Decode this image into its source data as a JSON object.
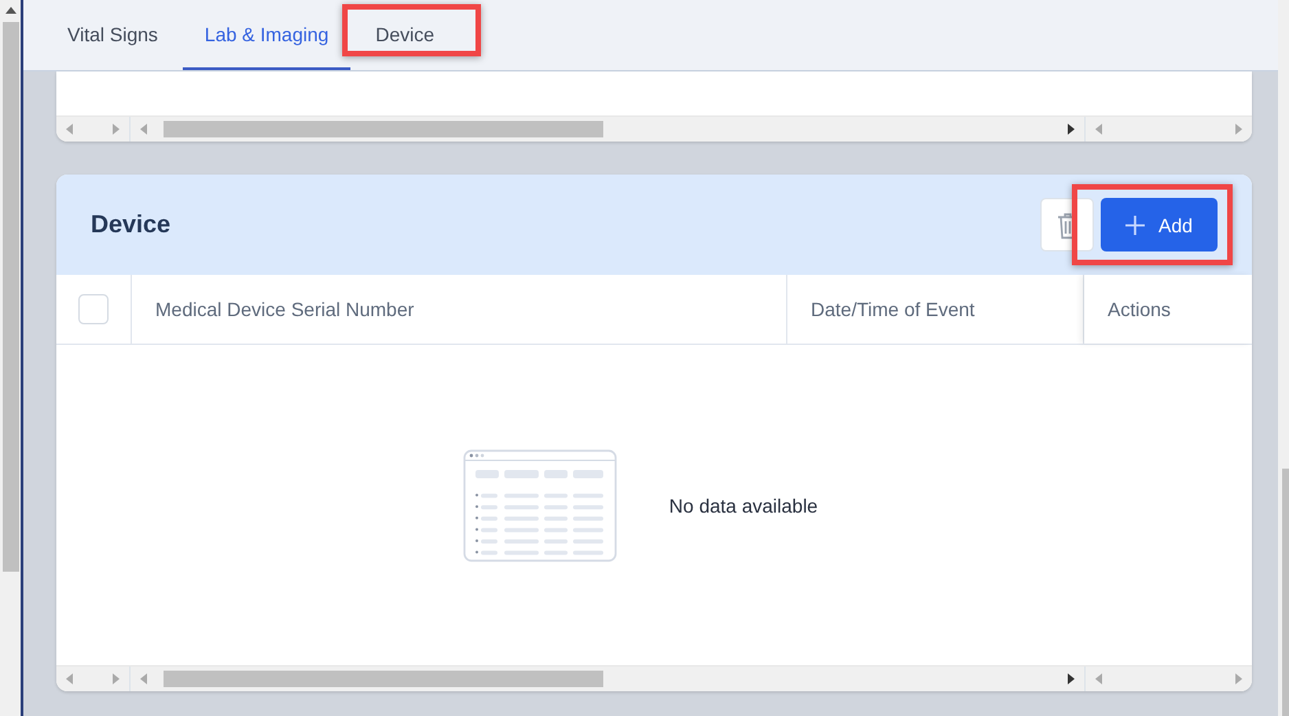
{
  "tabs": [
    {
      "label": "Vital Signs",
      "selected": false,
      "highlighted": false
    },
    {
      "label": "Lab & Imaging",
      "selected": true,
      "highlighted": false
    },
    {
      "label": "Device",
      "selected": false,
      "highlighted": true
    }
  ],
  "section": {
    "title": "Device",
    "actions": [
      {
        "kind": "delete",
        "highlighted": false
      },
      {
        "kind": "add",
        "label": "Add",
        "highlighted": true
      }
    ]
  },
  "table": {
    "select_all": {
      "checked": false
    },
    "columns": [
      "Medical Device Serial Number",
      "Date/Time of Event",
      "Actions"
    ],
    "empty_message": "No data available"
  }
}
